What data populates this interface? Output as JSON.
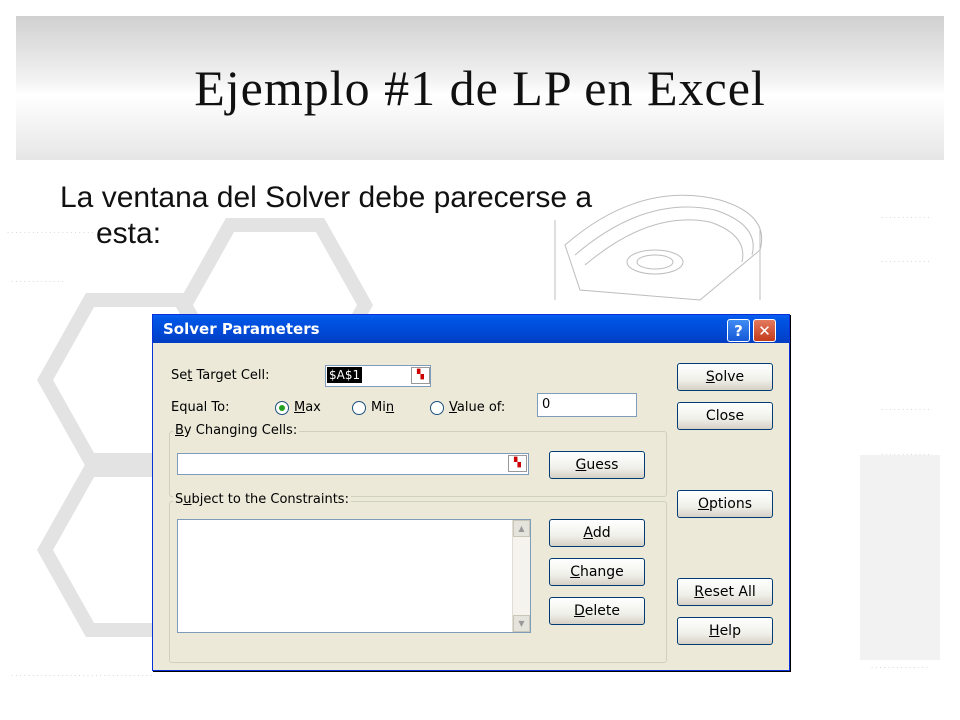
{
  "slide": {
    "title": "Ejemplo #1 de LP en Excel",
    "body_line1": "La ventana del Solver debe parecerse  a",
    "body_line2": "esta:"
  },
  "dialog": {
    "title": "Solver Parameters",
    "help_label": "?",
    "close_label": "✕",
    "set_target_cell": {
      "prefix": "Se",
      "accel": "t",
      "suffix": " Target Cell:",
      "value": "$A$1"
    },
    "equal_to": {
      "label": "Equal To:",
      "options": [
        {
          "accel": "M",
          "rest": "ax",
          "selected": true
        },
        {
          "pre": "Mi",
          "accel": "n",
          "rest": "",
          "selected": false
        },
        {
          "accel": "V",
          "rest": "alue of:",
          "selected": false
        }
      ],
      "value_of": "0"
    },
    "changing_cells": {
      "accel": "B",
      "rest": "y Changing Cells:",
      "value": ""
    },
    "constraints": {
      "accel": "u",
      "pre": "S",
      "rest": "bject to the Constraints:"
    },
    "buttons": {
      "solve": {
        "accel": "S",
        "rest": "olve"
      },
      "close": "Close",
      "guess": {
        "accel": "G",
        "rest": "uess"
      },
      "options": {
        "accel": "O",
        "rest": "ptions"
      },
      "add": {
        "accel": "A",
        "rest": "dd"
      },
      "change": {
        "accel": "C",
        "rest": "hange"
      },
      "delete": {
        "accel": "D",
        "rest": "elete"
      },
      "reset_all": {
        "accel": "R",
        "rest": "eset All"
      },
      "help": {
        "accel": "H",
        "rest": "elp"
      }
    }
  },
  "colors": {
    "titlebar": "#0054e3",
    "dialog_bg": "#ece9d8",
    "close_btn": "#c43a1c"
  }
}
